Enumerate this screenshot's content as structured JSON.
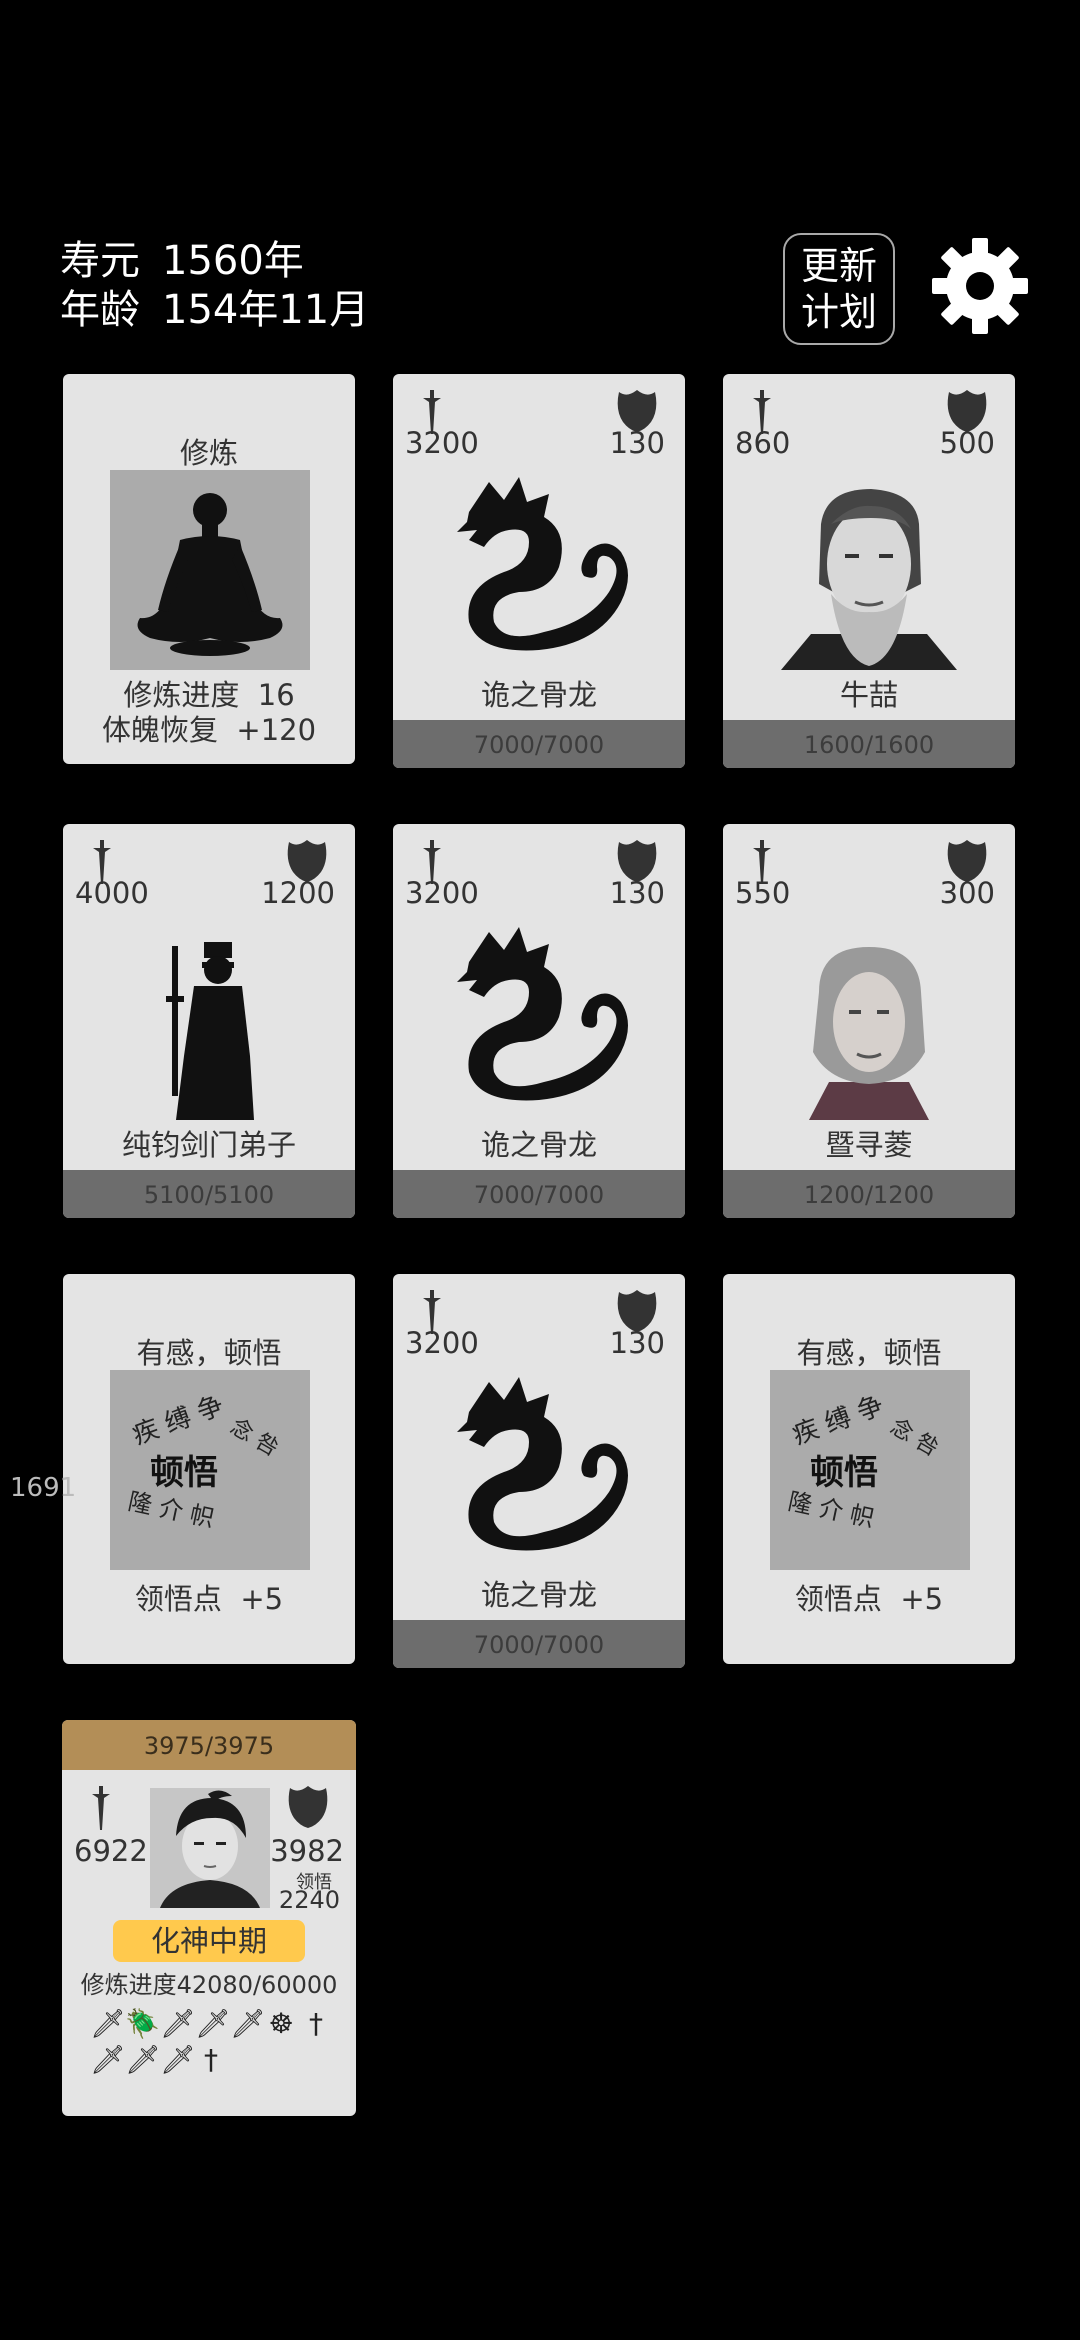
{
  "header": {
    "lifespan_label": "寿元",
    "lifespan_value": "1560年",
    "age_label": "年龄",
    "age_value": "154年11月",
    "update_button_line1": "更新",
    "update_button_line2": "计划",
    "settings_icon": "gear-icon"
  },
  "side_number": "1691",
  "cards": [
    {
      "type": "cultivate",
      "title": "修炼",
      "line1_label": "修炼进度",
      "line1_value": "16",
      "line2_label": "体魄恢复",
      "line2_value": "+120",
      "icon": "meditation-icon"
    },
    {
      "type": "enemy",
      "attack": "3200",
      "defense": "130",
      "name": "诡之骨龙",
      "hp": "7000/7000",
      "icon": "dragon-icon"
    },
    {
      "type": "enemy",
      "attack": "860",
      "defense": "500",
      "name": "牛喆",
      "hp": "1600/1600",
      "icon": "old-man-portrait"
    },
    {
      "type": "enemy",
      "attack": "4000",
      "defense": "1200",
      "name": "纯钧剑门弟子",
      "hp": "5100/5100",
      "icon": "swordsman-silhouette"
    },
    {
      "type": "enemy",
      "attack": "3200",
      "defense": "130",
      "name": "诡之骨龙",
      "hp": "7000/7000",
      "icon": "dragon-icon"
    },
    {
      "type": "enemy",
      "attack": "550",
      "defense": "300",
      "name": "暨寻菱",
      "hp": "1200/1200",
      "icon": "old-woman-portrait"
    },
    {
      "type": "insight",
      "title": "有感，顿悟",
      "bottom_label": "领悟点",
      "bottom_value": "+5",
      "icon": "calligraphy-icon"
    },
    {
      "type": "enemy",
      "attack": "3200",
      "defense": "130",
      "name": "诡之骨龙",
      "hp": "7000/7000",
      "icon": "dragon-icon"
    },
    {
      "type": "insight",
      "title": "有感，顿悟",
      "bottom_label": "领悟点",
      "bottom_value": "+5",
      "icon": "calligraphy-icon"
    }
  ],
  "player": {
    "hp": "3975/3975",
    "attack": "6922",
    "defense": "3982",
    "insight_label": "领悟",
    "insight_value": "2240",
    "realm": "化神中期",
    "progress_label": "修炼进度",
    "progress_value": "42080/60000",
    "skills_row1": [
      "🗡",
      "🪲",
      "🗡",
      "🗡",
      "🗡",
      "☸",
      "†"
    ],
    "skills_row2": [
      "🗡",
      "🗡",
      "🗡",
      "†"
    ],
    "colors": {
      "hp_bar": "#b38e57",
      "realm_badge": "#ffc94d"
    }
  }
}
